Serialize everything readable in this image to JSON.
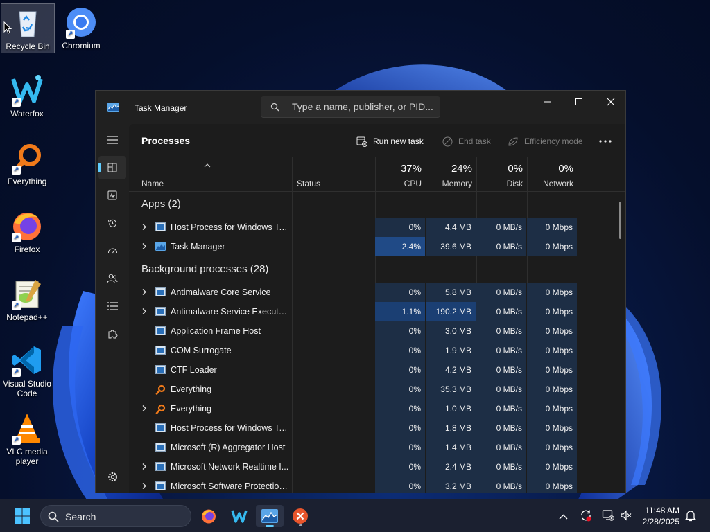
{
  "desktop": {
    "icons": [
      {
        "label": "Recycle Bin",
        "icon": "recycle-bin-icon"
      },
      {
        "label": "Chromium",
        "icon": "chromium-icon"
      },
      {
        "label": "Waterfox",
        "icon": "waterfox-icon"
      },
      {
        "label": "Everything",
        "icon": "everything-icon"
      },
      {
        "label": "Firefox",
        "icon": "firefox-icon"
      },
      {
        "label": "Notepad++",
        "icon": "notepadpp-icon"
      },
      {
        "label": "Visual Studio\nCode",
        "icon": "vscode-icon"
      },
      {
        "label": "VLC media\nplayer",
        "icon": "vlc-icon"
      }
    ]
  },
  "window": {
    "title": "Task Manager",
    "search_placeholder": "Type a name, publisher, or PID..."
  },
  "sidebar": {
    "items": [
      "Processes",
      "Performance",
      "App history",
      "Startup apps",
      "Users",
      "Details",
      "Services",
      "Settings"
    ],
    "active": "Processes"
  },
  "toolbar": {
    "title": "Processes",
    "run_new_task": "Run new task",
    "end_task": "End task",
    "efficiency_mode": "Efficiency mode"
  },
  "columns": {
    "name": "Name",
    "status": "Status",
    "cpu": {
      "pct": "37%",
      "label": "CPU"
    },
    "memory": {
      "pct": "24%",
      "label": "Memory"
    },
    "disk": {
      "pct": "0%",
      "label": "Disk"
    },
    "network": {
      "pct": "0%",
      "label": "Network"
    }
  },
  "groups": {
    "apps": "Apps (2)",
    "background": "Background processes (28)"
  },
  "apps": [
    {
      "name": "Host Process for Windows Tasks",
      "expandable": true,
      "icon": "generic",
      "cpu": "0%",
      "memory": "4.4 MB",
      "disk": "0 MB/s",
      "network": "0 Mbps",
      "cpu_heat": 0,
      "mem_heat": 0
    },
    {
      "name": "Task Manager",
      "expandable": true,
      "icon": "taskmgr",
      "cpu": "2.4%",
      "memory": "39.6 MB",
      "disk": "0 MB/s",
      "network": "0 Mbps",
      "cpu_heat": 3,
      "mem_heat": 0
    }
  ],
  "background": [
    {
      "name": "Antimalware Core Service",
      "expandable": true,
      "icon": "generic",
      "cpu": "0%",
      "memory": "5.8 MB",
      "disk": "0 MB/s",
      "network": "0 Mbps",
      "cpu_heat": 0,
      "mem_heat": 0
    },
    {
      "name": "Antimalware Service Executable",
      "expandable": true,
      "icon": "generic",
      "cpu": "1.1%",
      "memory": "190.2 MB",
      "disk": "0 MB/s",
      "network": "0 Mbps",
      "cpu_heat": 2,
      "mem_heat": 2
    },
    {
      "name": "Application Frame Host",
      "expandable": false,
      "icon": "generic",
      "cpu": "0%",
      "memory": "3.0 MB",
      "disk": "0 MB/s",
      "network": "0 Mbps",
      "cpu_heat": 0,
      "mem_heat": 0
    },
    {
      "name": "COM Surrogate",
      "expandable": false,
      "icon": "generic",
      "cpu": "0%",
      "memory": "1.9 MB",
      "disk": "0 MB/s",
      "network": "0 Mbps",
      "cpu_heat": 0,
      "mem_heat": 0
    },
    {
      "name": "CTF Loader",
      "expandable": false,
      "icon": "generic",
      "cpu": "0%",
      "memory": "4.2 MB",
      "disk": "0 MB/s",
      "network": "0 Mbps",
      "cpu_heat": 0,
      "mem_heat": 0
    },
    {
      "name": "Everything",
      "expandable": false,
      "icon": "everything",
      "cpu": "0%",
      "memory": "35.3 MB",
      "disk": "0 MB/s",
      "network": "0 Mbps",
      "cpu_heat": 0,
      "mem_heat": 0
    },
    {
      "name": "Everything",
      "expandable": true,
      "icon": "everything",
      "cpu": "0%",
      "memory": "1.0 MB",
      "disk": "0 MB/s",
      "network": "0 Mbps",
      "cpu_heat": 0,
      "mem_heat": 0
    },
    {
      "name": "Host Process for Windows Tasks",
      "expandable": false,
      "icon": "generic",
      "cpu": "0%",
      "memory": "1.8 MB",
      "disk": "0 MB/s",
      "network": "0 Mbps",
      "cpu_heat": 0,
      "mem_heat": 0
    },
    {
      "name": "Microsoft (R) Aggregator Host",
      "expandable": false,
      "icon": "generic",
      "cpu": "0%",
      "memory": "1.4 MB",
      "disk": "0 MB/s",
      "network": "0 Mbps",
      "cpu_heat": 0,
      "mem_heat": 0
    },
    {
      "name": "Microsoft Network Realtime I...",
      "expandable": true,
      "icon": "generic",
      "cpu": "0%",
      "memory": "2.4 MB",
      "disk": "0 MB/s",
      "network": "0 Mbps",
      "cpu_heat": 0,
      "mem_heat": 0
    },
    {
      "name": "Microsoft Software Protection...",
      "expandable": true,
      "icon": "generic",
      "cpu": "0%",
      "memory": "3.2 MB",
      "disk": "0 MB/s",
      "network": "0 Mbps",
      "cpu_heat": 0,
      "mem_heat": 0
    }
  ],
  "taskbar": {
    "search_label": "Search",
    "time": "11:48 AM",
    "date": "2/28/2025",
    "apps": [
      "start-icon",
      "firefox-icon",
      "waterfox-icon",
      "task-manager-icon",
      "close-app-icon"
    ]
  }
}
